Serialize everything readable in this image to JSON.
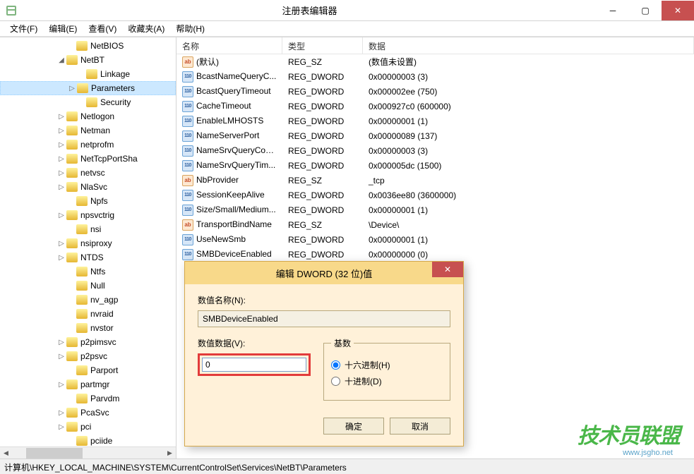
{
  "window": {
    "title": "注册表编辑器"
  },
  "menu": [
    "文件(F)",
    "编辑(E)",
    "查看(V)",
    "收藏夹(A)",
    "帮助(H)"
  ],
  "tree": [
    {
      "indent": 94,
      "exp": "",
      "label": "NetBIOS"
    },
    {
      "indent": 80,
      "exp": "◢",
      "label": "NetBT"
    },
    {
      "indent": 108,
      "exp": "",
      "label": "Linkage"
    },
    {
      "indent": 94,
      "exp": "▷",
      "label": "Parameters",
      "selected": true
    },
    {
      "indent": 108,
      "exp": "",
      "label": "Security"
    },
    {
      "indent": 80,
      "exp": "▷",
      "label": "Netlogon"
    },
    {
      "indent": 80,
      "exp": "▷",
      "label": "Netman"
    },
    {
      "indent": 80,
      "exp": "▷",
      "label": "netprofm"
    },
    {
      "indent": 80,
      "exp": "▷",
      "label": "NetTcpPortSha"
    },
    {
      "indent": 80,
      "exp": "▷",
      "label": "netvsc"
    },
    {
      "indent": 80,
      "exp": "▷",
      "label": "NlaSvc"
    },
    {
      "indent": 94,
      "exp": "",
      "label": "Npfs"
    },
    {
      "indent": 80,
      "exp": "▷",
      "label": "npsvctrig"
    },
    {
      "indent": 94,
      "exp": "",
      "label": "nsi"
    },
    {
      "indent": 80,
      "exp": "▷",
      "label": "nsiproxy"
    },
    {
      "indent": 80,
      "exp": "▷",
      "label": "NTDS"
    },
    {
      "indent": 94,
      "exp": "",
      "label": "Ntfs"
    },
    {
      "indent": 94,
      "exp": "",
      "label": "Null"
    },
    {
      "indent": 94,
      "exp": "",
      "label": "nv_agp"
    },
    {
      "indent": 94,
      "exp": "",
      "label": "nvraid"
    },
    {
      "indent": 94,
      "exp": "",
      "label": "nvstor"
    },
    {
      "indent": 80,
      "exp": "▷",
      "label": "p2pimsvc"
    },
    {
      "indent": 80,
      "exp": "▷",
      "label": "p2psvc"
    },
    {
      "indent": 94,
      "exp": "",
      "label": "Parport"
    },
    {
      "indent": 80,
      "exp": "▷",
      "label": "partmgr"
    },
    {
      "indent": 94,
      "exp": "",
      "label": "Parvdm"
    },
    {
      "indent": 80,
      "exp": "▷",
      "label": "PcaSvc"
    },
    {
      "indent": 80,
      "exp": "▷",
      "label": "pci"
    },
    {
      "indent": 94,
      "exp": "",
      "label": "pciide"
    }
  ],
  "list": {
    "headers": {
      "name": "名称",
      "type": "类型",
      "data": "数据"
    },
    "rows": [
      {
        "icon": "sz",
        "name": "(默认)",
        "type": "REG_SZ",
        "data": "(数值未设置)"
      },
      {
        "icon": "dw",
        "name": "BcastNameQueryC...",
        "type": "REG_DWORD",
        "data": "0x00000003 (3)"
      },
      {
        "icon": "dw",
        "name": "BcastQueryTimeout",
        "type": "REG_DWORD",
        "data": "0x000002ee (750)"
      },
      {
        "icon": "dw",
        "name": "CacheTimeout",
        "type": "REG_DWORD",
        "data": "0x000927c0 (600000)"
      },
      {
        "icon": "dw",
        "name": "EnableLMHOSTS",
        "type": "REG_DWORD",
        "data": "0x00000001 (1)"
      },
      {
        "icon": "dw",
        "name": "NameServerPort",
        "type": "REG_DWORD",
        "data": "0x00000089 (137)"
      },
      {
        "icon": "dw",
        "name": "NameSrvQueryCount",
        "type": "REG_DWORD",
        "data": "0x00000003 (3)"
      },
      {
        "icon": "dw",
        "name": "NameSrvQueryTim...",
        "type": "REG_DWORD",
        "data": "0x000005dc (1500)"
      },
      {
        "icon": "sz",
        "name": "NbProvider",
        "type": "REG_SZ",
        "data": "_tcp"
      },
      {
        "icon": "dw",
        "name": "SessionKeepAlive",
        "type": "REG_DWORD",
        "data": "0x0036ee80 (3600000)"
      },
      {
        "icon": "dw",
        "name": "Size/Small/Medium...",
        "type": "REG_DWORD",
        "data": "0x00000001 (1)"
      },
      {
        "icon": "sz",
        "name": "TransportBindName",
        "type": "REG_SZ",
        "data": "\\Device\\"
      },
      {
        "icon": "dw",
        "name": "UseNewSmb",
        "type": "REG_DWORD",
        "data": "0x00000001 (1)"
      },
      {
        "icon": "dw",
        "name": "SMBDeviceEnabled",
        "type": "REG_DWORD",
        "data": "0x00000000 (0)"
      }
    ]
  },
  "statusbar": "计算机\\HKEY_LOCAL_MACHINE\\SYSTEM\\CurrentControlSet\\Services\\NetBT\\Parameters",
  "dialog": {
    "title": "编辑 DWORD (32 位)值",
    "name_label": "数值名称(N):",
    "name_value": "SMBDeviceEnabled",
    "data_label": "数值数据(V):",
    "data_value": "0",
    "base_legend": "基数",
    "radio_hex": "十六进制(H)",
    "radio_dec": "十进制(D)",
    "ok": "确定",
    "cancel": "取消"
  },
  "watermark": {
    "text": "技术员联盟",
    "url": "www.jsgho.net"
  }
}
